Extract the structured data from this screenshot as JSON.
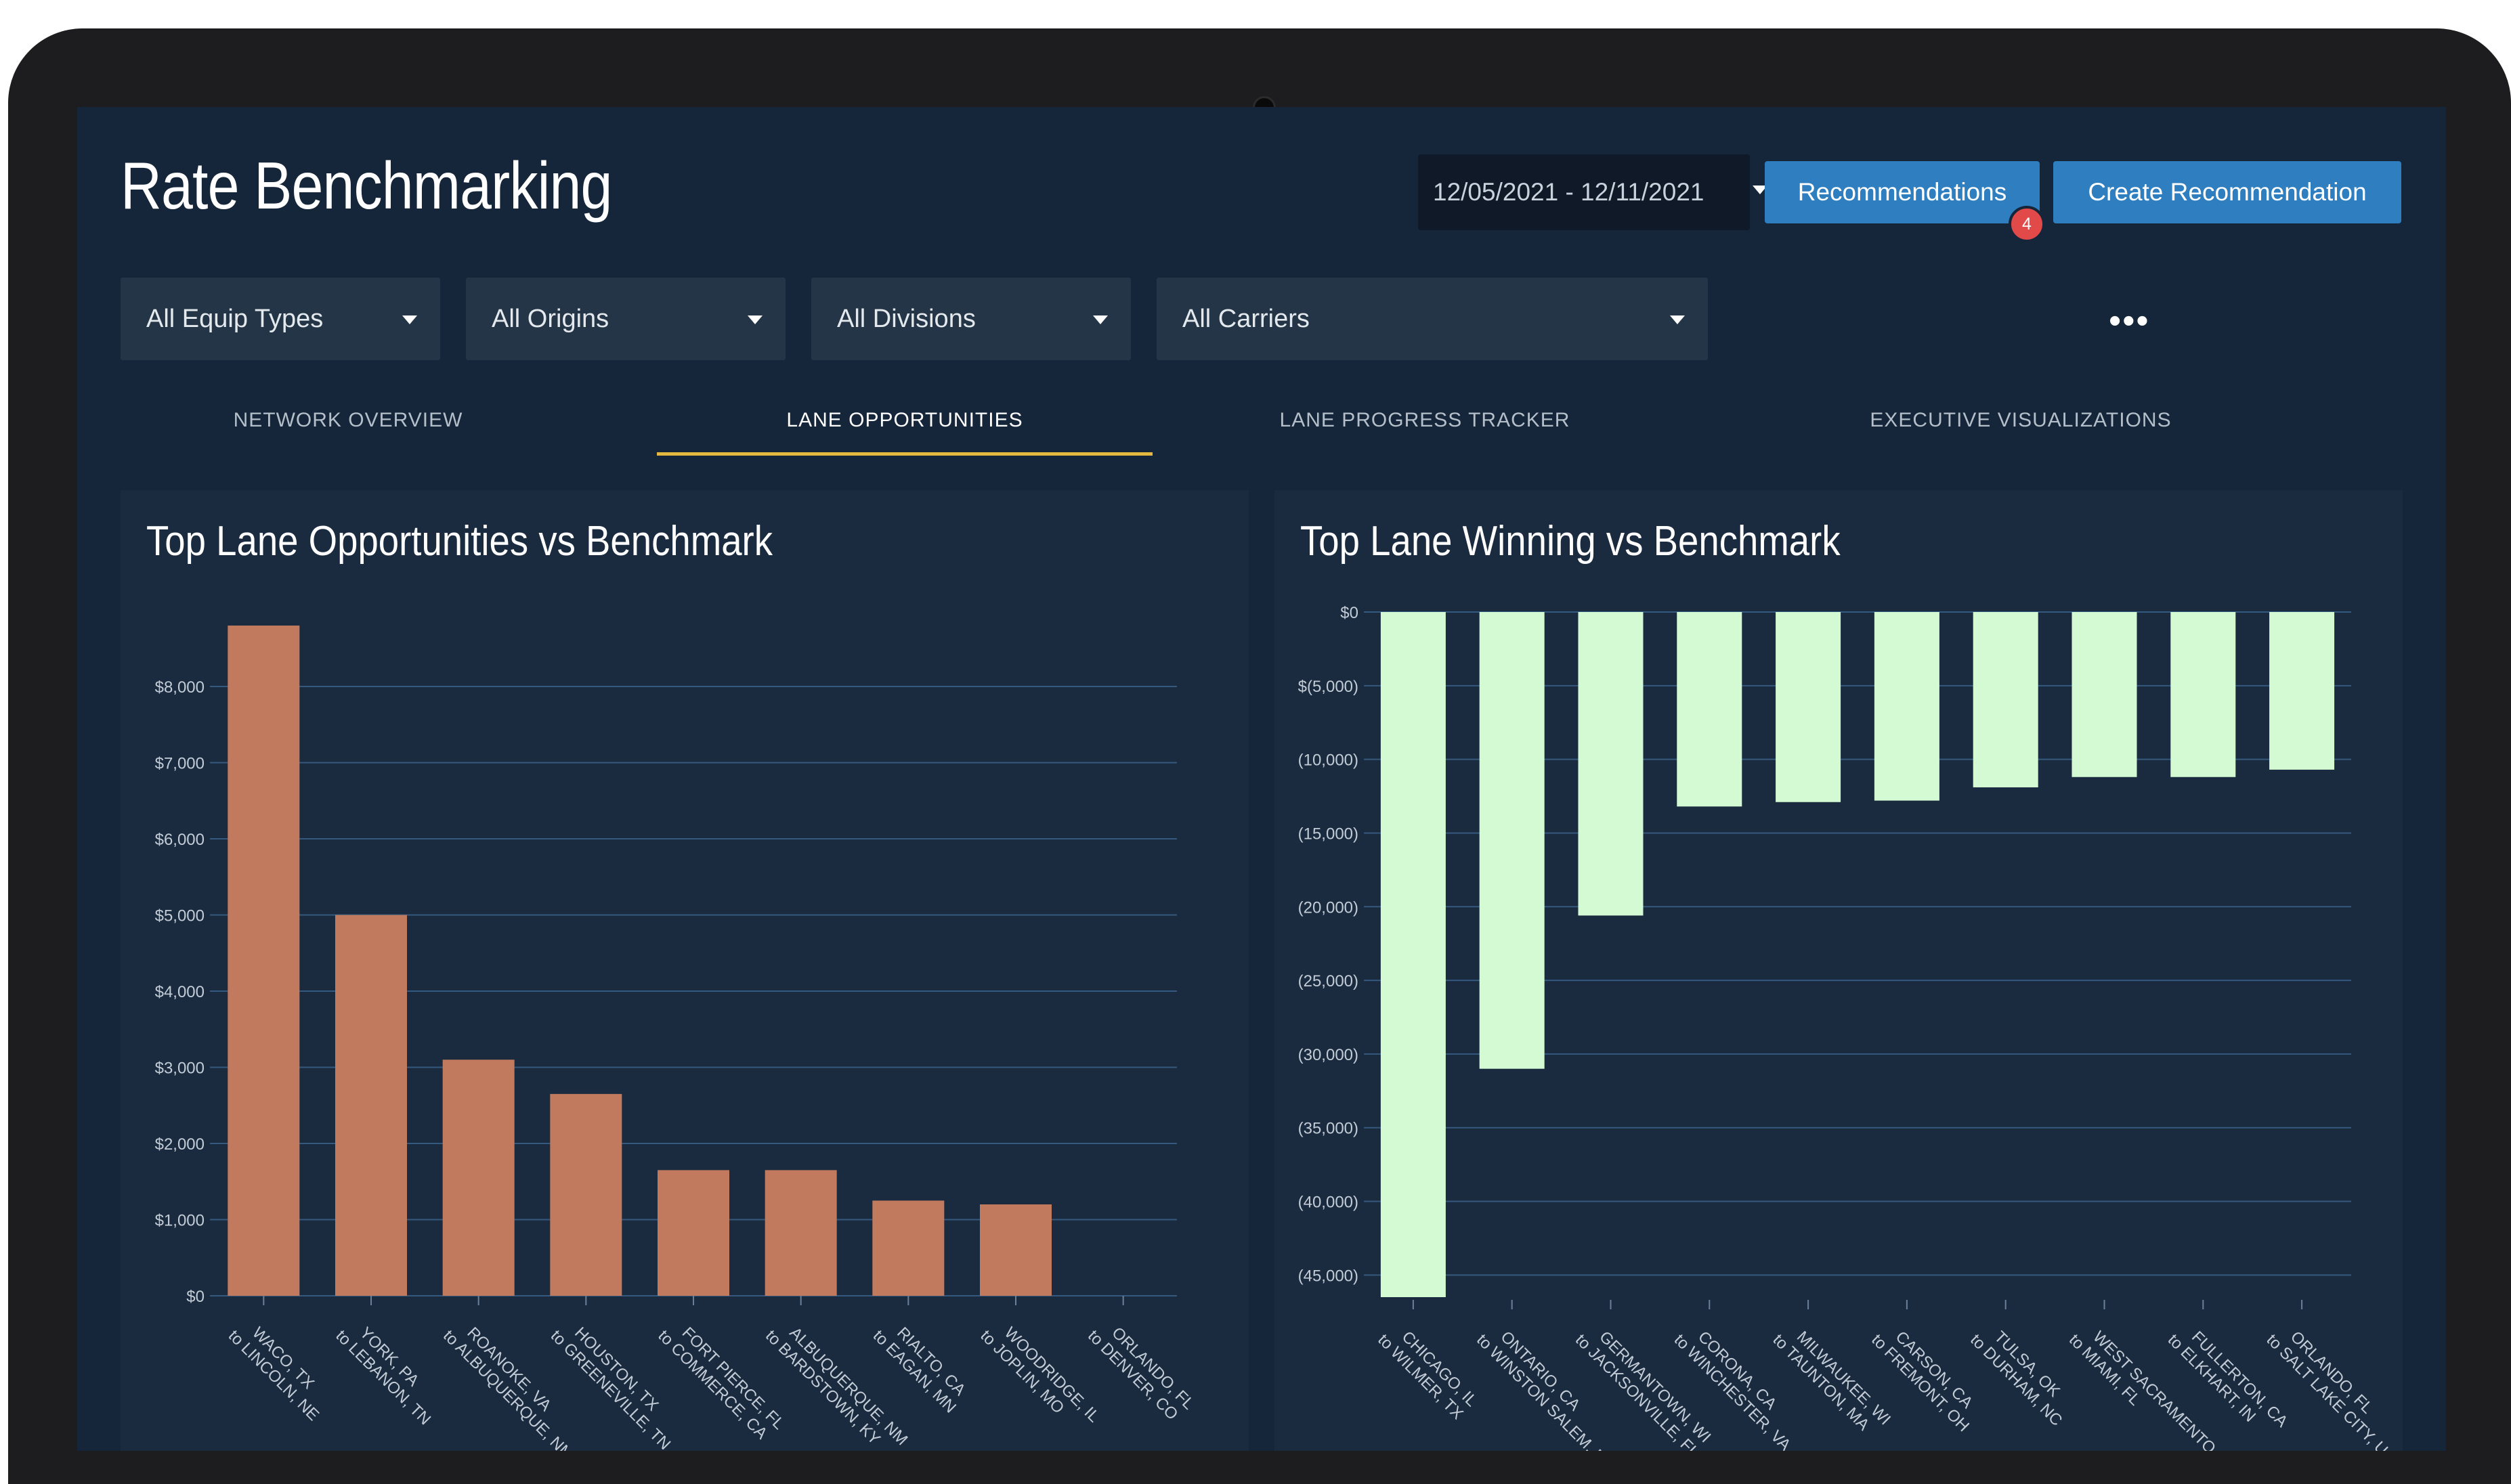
{
  "header": {
    "title": "Rate Benchmarking",
    "date_range": "12/05/2021 - 12/11/2021",
    "recommendations_label": "Recommendations",
    "recommendations_badge": "4",
    "create_label": "Create Recommendation"
  },
  "filters": {
    "equip": "All Equip Types",
    "origins": "All Origins",
    "divisions": "All Divisions",
    "carriers": "All Carriers",
    "more": "•••"
  },
  "tabs": [
    "NETWORK OVERVIEW",
    "LANE OPPORTUNITIES",
    "LANE PROGRESS TRACKER",
    "EXECUTIVE VISUALIZATIONS"
  ],
  "active_tab": "LANE OPPORTUNITIES",
  "colors": {
    "opportunity_bar": "#c27a5f",
    "winning_bar": "#d4fad4",
    "accent_tab": "#e5b83f",
    "button": "#2f7fc0",
    "badge": "#e24a4a"
  },
  "chart_data": [
    {
      "type": "bar",
      "title": "Top Lane Opportunities vs Benchmark",
      "categories": [
        [
          "WACO, TX",
          "to LINCOLN, NE"
        ],
        [
          "YORK, PA",
          "to LEBANON, TN"
        ],
        [
          "ROANOKE, VA",
          "to ALBUQUERQUE, NM"
        ],
        [
          "HOUSTON, TX",
          "to GREENEVILLE, TN"
        ],
        [
          "FORT PIERCE, FL",
          "to COMMERCE, CA"
        ],
        [
          "ALBUQUERQUE, NM",
          "to BARDSTOWN, KY"
        ],
        [
          "RIALTO, CA",
          "to EAGAN, MN"
        ],
        [
          "WOODRIDGE, IL",
          "to JOPLIN, MO"
        ],
        [
          "ORLANDO, FL",
          "to DENVER, CO"
        ]
      ],
      "values": [
        8800,
        5000,
        3100,
        2650,
        1650,
        1650,
        1250,
        1200,
        0
      ],
      "ylim": [
        0,
        8800
      ],
      "yticks": [
        0,
        1000,
        2000,
        3000,
        4000,
        5000,
        6000,
        7000,
        8000
      ],
      "ytick_labels": [
        "$0",
        "$1,000",
        "$2,000",
        "$3,000",
        "$4,000",
        "$5,000",
        "$6,000",
        "$7,000",
        "$8,000"
      ],
      "grid": true,
      "xlabel": "",
      "ylabel": ""
    },
    {
      "type": "bar",
      "title": "Top Lane Winning vs Benchmark",
      "categories": [
        [
          "CHICAGO, IL",
          "to WILMER, TX"
        ],
        [
          "ONTARIO, CA",
          "to WINSTON SALEM, NC"
        ],
        [
          "GERMANTOWN, WI",
          "to JACKSONVILLE, FL"
        ],
        [
          "CORONA, CA",
          "to WINCHESTER, VA"
        ],
        [
          "MILWAUKEE, WI",
          "to TAUNTON, MA"
        ],
        [
          "CARSON, CA",
          "to FREMONT, OH"
        ],
        [
          "TULSA, OK",
          "to DURHAM, NC"
        ],
        [
          "WEST SACRAMENTO, CA",
          "to MIAMI, FL"
        ],
        [
          "FULLERTON, CA",
          "to ELKHART, IN"
        ],
        [
          "ORLANDO, FL",
          "to SALT LAKE CITY, U"
        ]
      ],
      "values": [
        -46500,
        -31000,
        -20600,
        -13200,
        -12900,
        -12800,
        -11900,
        -11200,
        -11200,
        -10700
      ],
      "ylim": [
        -46500,
        0
      ],
      "yticks": [
        0,
        -5000,
        -10000,
        -15000,
        -20000,
        -25000,
        -30000,
        -35000,
        -40000,
        -45000
      ],
      "ytick_labels": [
        "$0",
        "$(5,000)",
        "(10,000)",
        "(15,000)",
        "(20,000)",
        "(25,000)",
        "(30,000)",
        "(35,000)",
        "(40,000)",
        "(45,000)"
      ],
      "grid": true,
      "xlabel": "",
      "ylabel": ""
    }
  ]
}
